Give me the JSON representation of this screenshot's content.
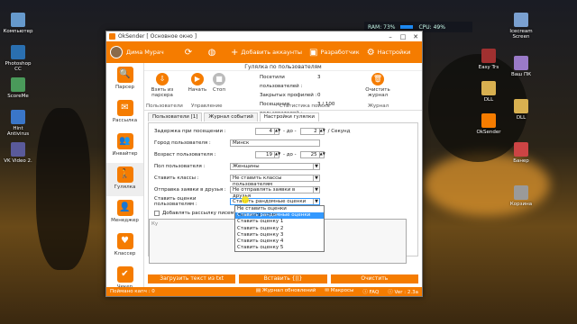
{
  "desktop": {
    "icons_left": [
      {
        "label": "Компьютер",
        "color": "#6699cc"
      },
      {
        "label": "Photoshop CC",
        "color": "#2a6fb0"
      },
      {
        "label": "ScoreMe",
        "color": "#4a9a5a"
      },
      {
        "label": "Hint Antivirus",
        "color": "#3a76c8"
      },
      {
        "label": "VK Video 2.",
        "color": "#5a5a9a"
      }
    ],
    "icons_right": [
      {
        "label": "Icecream Screen",
        "color": "#7aa0d0"
      },
      {
        "label": "Ваш ПК",
        "color": "#9a7ac8"
      },
      {
        "label": "DLL",
        "color": "#d8b050"
      },
      {
        "label": "Банер",
        "color": "#cc4444"
      },
      {
        "label": "Корзина",
        "color": "#9a9a9a"
      }
    ],
    "icons_right2": [
      {
        "label": "Easy Trs",
        "color": "#a03030"
      },
      {
        "label": "DLL",
        "color": "#d8b050"
      },
      {
        "label": "OkSender",
        "color": "#f57c00"
      }
    ]
  },
  "sysmon": {
    "ram": "RAM: 73%",
    "cpu": "CPU: 49%"
  },
  "window": {
    "title": "OkSender [ Основное окно ]",
    "user_name": "Дима Мурач",
    "topbar": {
      "add_accounts": "Добавить аккаунты",
      "developer": "Разработчик",
      "settings": "Настройки"
    },
    "sidebar": [
      {
        "label": "Парсер",
        "icon": "🔍"
      },
      {
        "label": "Рассылка",
        "icon": "✉"
      },
      {
        "label": "Инвайтер",
        "icon": "👥"
      },
      {
        "label": "Гулялка",
        "icon": "🚶"
      },
      {
        "label": "Менеджер",
        "icon": "👤"
      },
      {
        "label": "Классер",
        "icon": "♥"
      },
      {
        "label": "Чекер",
        "icon": "✔"
      }
    ],
    "ribbon": {
      "title": "Гулялка по пользователям",
      "users_group": {
        "btn": "Взять из парсера",
        "caption": "Пользователи"
      },
      "control": {
        "start": "Начать",
        "stop": "Стоп",
        "caption": "Управление"
      },
      "stats": [
        {
          "label": "Посетили пользователей :",
          "value": "3"
        },
        {
          "label": "Закрытых профилей :",
          "value": "0"
        },
        {
          "label": "Посещения пользователей :",
          "value": "3 / 100"
        }
      ],
      "stats_caption": "Статистика поиска",
      "journal": {
        "btn": "Очистить журнал",
        "caption": "Журнал"
      }
    },
    "tabs": [
      "Пользователи [1]",
      "Журнал событий",
      "Настройки гулялки"
    ],
    "form": {
      "delay_label": "Задержка при посещении :",
      "delay_from": "4",
      "delay_to": "2",
      "delay_unit": "/ Секунд",
      "city_label": "Город пользователя :",
      "city_value": "Минск",
      "age_label": "Возраст пользователя :",
      "age_from": "19",
      "age_to": "25",
      "sex_label": "Пол пользователя :",
      "sex_value": "Женщины",
      "classes_label": "Ставить классы :",
      "classes_value": "Не ставить классы пользователям",
      "friends_label": "Отправка заявки в друзья :",
      "friends_value": "Не отправлять заявки в друзья",
      "rating_label": "Ставить оценки пользователям :",
      "rating_value": "Ставить рандомные оценки",
      "mailing_checkbox": "Добавлять рассылку писем пол",
      "textarea_value": "Ку",
      "from": "- до -",
      "from2": "- до -"
    },
    "dropdown": [
      "Не ставить оценки пользователям",
      "Ставить рандомные оценки",
      "Ставить оценку 1",
      "Ставить оценку 2",
      "Ставить оценку 3",
      "Ставить оценку 4",
      "Ставить оценку 5"
    ],
    "actions": {
      "load": "Загрузить текст из txt",
      "insert": "Вставить {||}",
      "clear": "Очистить"
    },
    "statusbar": {
      "left": "Поймано капч : 0",
      "updates": "Журнал обновлений",
      "macros": "Макросы",
      "faq": "FAQ",
      "version": "Ver : 2.3a"
    }
  }
}
